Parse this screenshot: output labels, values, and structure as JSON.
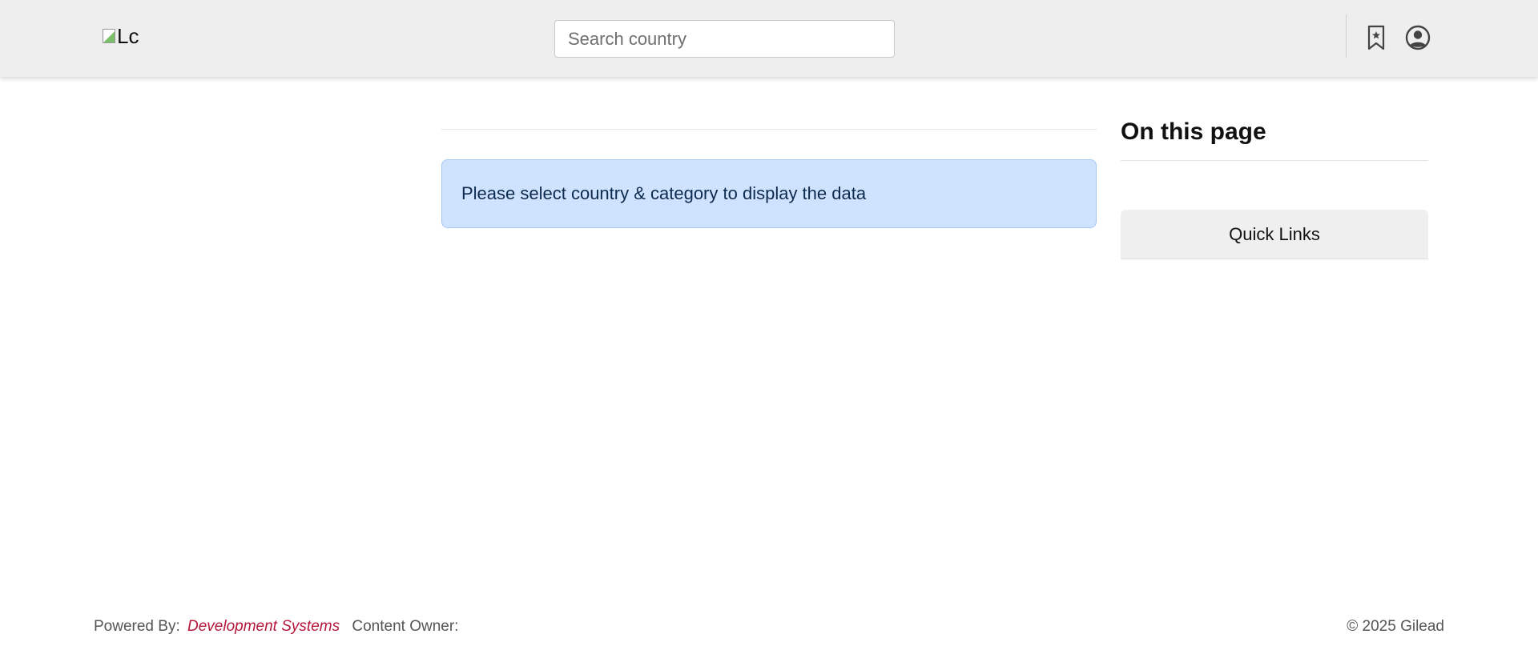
{
  "header": {
    "logo_alt": "Lc",
    "search": {
      "placeholder": "Search country",
      "value": ""
    },
    "icons": {
      "bookmark": "bookmark-star-icon",
      "account": "user-circle-icon"
    }
  },
  "main": {
    "alert_text": "Please select country & category to display the data"
  },
  "sidebar": {
    "title": "On this page",
    "quick_links_label": "Quick Links"
  },
  "footer": {
    "powered_by_label": "Powered By:",
    "powered_by_link": "Development Systems",
    "content_owner_label": "Content Owner:",
    "copyright": "© 2025 Gilead"
  },
  "colors": {
    "header_bg": "#eeeeee",
    "alert_bg": "#cfe2fe",
    "link_accent": "#b5173a"
  }
}
